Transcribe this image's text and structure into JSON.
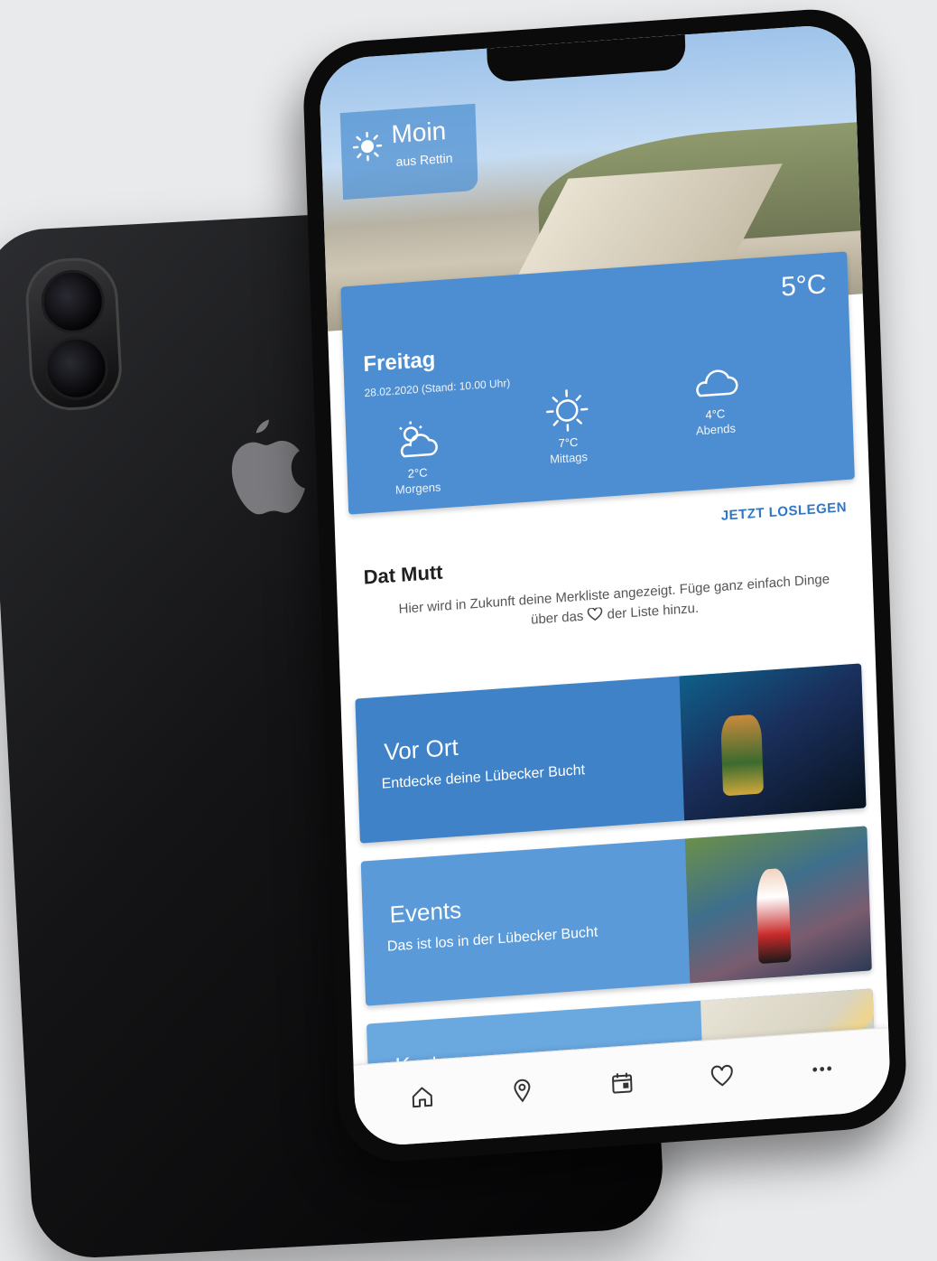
{
  "header": {
    "greeting_title": "Moin",
    "greeting_subtitle": "aus Rettin"
  },
  "weather": {
    "current_temp": "5°C",
    "day": "Freitag",
    "date_status": "28.02.2020 (Stand: 10.00 Uhr)",
    "slots": [
      {
        "temp": "2°C",
        "label": "Morgens",
        "icon": "partly-cloudy-icon"
      },
      {
        "temp": "7°C",
        "label": "Mittags",
        "icon": "sun-icon"
      },
      {
        "temp": "4°C",
        "label": "Abends",
        "icon": "cloud-icon"
      }
    ]
  },
  "merkliste": {
    "title": "Dat Mutt",
    "cta": "JETZT LOSLEGEN",
    "text_before": "Hier wird in Zukunft deine Merkliste angezeigt. Füge ganz einfach Dinge über das",
    "text_after": "der Liste hinzu."
  },
  "cards": [
    {
      "title": "Vor Ort",
      "subtitle": "Entdecke deine Lübecker Bucht"
    },
    {
      "title": "Events",
      "subtitle": "Das ist los in der Lübecker Bucht"
    },
    {
      "title": "Karte",
      "subtitle": ""
    }
  ],
  "tabbar": [
    "home-icon",
    "location-pin-icon",
    "calendar-icon",
    "heart-icon",
    "more-icon"
  ],
  "colors": {
    "primary_blue": "#4d8ed2",
    "cta_blue": "#2f77c4",
    "card_light_blue": "#5b9ad9"
  }
}
